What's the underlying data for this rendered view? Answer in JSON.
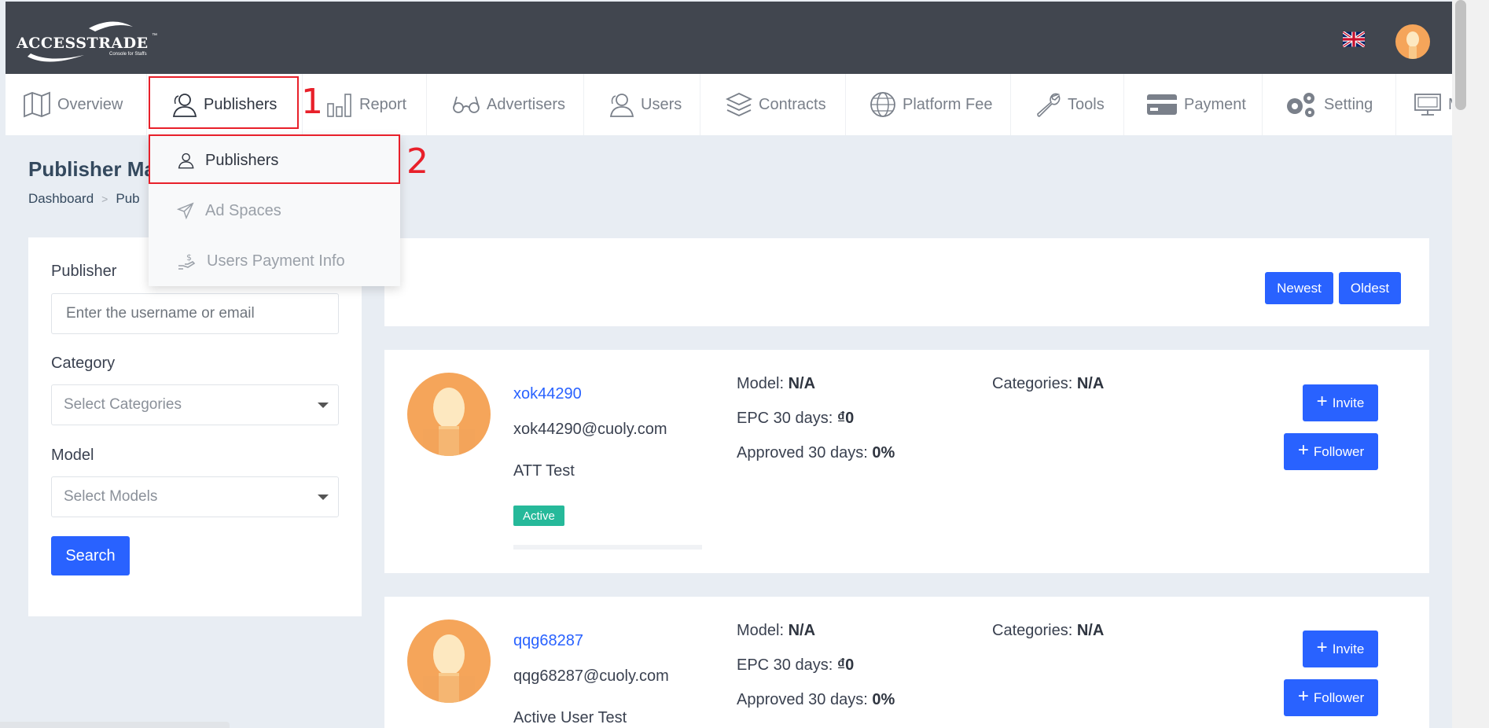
{
  "header": {
    "logo_text": "ACCESSTRADE",
    "logo_tm": "™",
    "logo_sub": "Console for Staffs"
  },
  "nav": {
    "items": [
      {
        "label": "Overview",
        "icon": "map-icon"
      },
      {
        "label": "Publishers",
        "icon": "users-icon"
      },
      {
        "label": "Report",
        "icon": "bar-chart-icon"
      },
      {
        "label": "Advertisers",
        "icon": "glasses-icon"
      },
      {
        "label": "Users",
        "icon": "users-icon"
      },
      {
        "label": "Contracts",
        "icon": "layers-icon"
      },
      {
        "label": "Platform Fee",
        "icon": "globe-icon"
      },
      {
        "label": "Tools",
        "icon": "wrench-icon"
      },
      {
        "label": "Payment",
        "icon": "credit-card-icon"
      },
      {
        "label": "Setting",
        "icon": "gears-icon"
      },
      {
        "label": "M",
        "icon": "monitor-icon"
      }
    ]
  },
  "dropdown": {
    "items": [
      {
        "label": "Publishers",
        "icon": "users-icon"
      },
      {
        "label": "Ad Spaces",
        "icon": "paper-plane-icon"
      },
      {
        "label": "Users Payment Info",
        "icon": "hand-dollar-icon"
      }
    ]
  },
  "annotations": {
    "one": "1",
    "two": "2"
  },
  "page": {
    "title": "Publisher Ma",
    "breadcrumb": [
      "Dashboard",
      "Pub"
    ]
  },
  "filter": {
    "publisher_label": "Publisher",
    "publisher_placeholder": "Enter the username or email",
    "category_label": "Category",
    "category_value": "Select Categories",
    "model_label": "Model",
    "model_value": "Select Models",
    "search_label": "Search"
  },
  "sort": {
    "newest": "Newest",
    "oldest": "Oldest"
  },
  "labels": {
    "model": "Model:",
    "epc": "EPC 30 days:",
    "approved": "Approved 30 days:",
    "categories": "Categories:",
    "invite": "Invite",
    "follower": "Follower",
    "plus": "+"
  },
  "publishers": [
    {
      "username": "xok44290",
      "email": "xok44290@cuoly.com",
      "name": "ATT Test",
      "status": "Active",
      "model": "N/A",
      "epc": "₫0",
      "approved": "0%",
      "categories": "N/A"
    },
    {
      "username": "qqg68287",
      "email": "qqg68287@cuoly.com",
      "name": "Active User Test",
      "model": "N/A",
      "epc": "₫0",
      "approved": "0%",
      "categories": "N/A"
    }
  ],
  "colors": {
    "topbar": "#41464f",
    "accent": "#2962ff",
    "active_badge": "#26b99a",
    "annotation": "#e8202a",
    "avatar": "#f5a55a"
  }
}
